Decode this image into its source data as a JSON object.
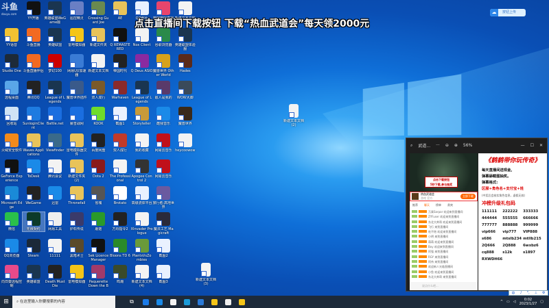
{
  "watermark": {
    "logo": "斗鱼",
    "site": "douyu.com"
  },
  "banner": "点击直播间下载按钮  下载“热血武道会”每天领2000元",
  "cloud_button": {
    "icon": "baidu-netdisk-icon",
    "label": "按钮上传"
  },
  "desktop": {
    "rows": [
      [
        [
          "YY开播",
          "#111"
        ],
        [
          "英雄联盟WeGame版",
          "#1a3550"
        ],
        [
          "遥控精灵",
          "#6a7fc4"
        ],
        [
          "Crossing Guard Joe",
          "#6a8a50"
        ],
        [
          "AE",
          "#e8c35a"
        ],
        [
          "QQ图片",
          "#e9f1ff"
        ],
        [
          "哔哩哔哩直播姬",
          "#e8456c"
        ],
        [
          "新建文本文档",
          "#f3f3f3"
        ]
      ],
      [
        [
          "YY语音",
          "#f2c232"
        ],
        [
          "斗鱼直播",
          "#f26a22"
        ],
        [
          "英雄联盟",
          "#1a3550"
        ],
        [
          "雷电模拟器",
          "#f5c518"
        ],
        [
          "新建文件夹",
          "#e8c35a"
        ],
        [
          "Q REMASTERED",
          "#111"
        ],
        [
          "Nox Client",
          "#f3f3f3"
        ],
        [
          "谷歌浏览器",
          "#2a8a4a"
        ],
        [
          "英雄联盟体验服",
          "#1a3550"
        ]
      ],
      [
        [
          "Studio One",
          "#1d2a38"
        ],
        [
          "斗鱼直播伴侣",
          "#f26a22"
        ],
        [
          "梦幻100",
          "#c00"
        ],
        [
          "网易UU加速器",
          "#3a7bd5"
        ],
        [
          "新建文本文档",
          "#f3f3f3"
        ],
        [
          "帝国时代",
          "#222"
        ],
        [
          "Q Deus ASIO",
          "#8a2aa0"
        ],
        [
          "魔兽世界 Other World",
          "#d6a21c"
        ],
        [
          "Hades",
          "#5a2a1a"
        ]
      ],
      [
        [
          "远程桌面",
          "#5aa6e8"
        ],
        [
          "腾讯QQ",
          "#222"
        ],
        [
          "League of Legends",
          "#1a3550"
        ],
        [
          "魔兽世界插件",
          "#3a5a8a"
        ],
        [
          "双人成行",
          "#7a5a2a"
        ],
        [
          "Warhaven",
          "#8a2a2a"
        ],
        [
          "League of Legends",
          "#1a3550"
        ],
        [
          "敌人是我的",
          "#5a3a6a"
        ],
        [
          "WOW大脚",
          "#3a4a5a"
        ]
      ],
      [
        [
          "回收站",
          "#cfe3f5"
        ],
        [
          "SunloginClient",
          "#1e7be0"
        ],
        [
          "Battle.net",
          "#1a6ee0"
        ],
        [
          "暴雪战网",
          "#1a6ee0"
        ],
        [
          "KOOK",
          "#6fdc2a"
        ],
        [
          "截图1",
          "#e9f1ff"
        ],
        [
          "Storyteller",
          "#c79a3a"
        ],
        [
          "酷我音乐",
          "#1a8ae8"
        ],
        [
          "魔兽世界",
          "#3a2a1a"
        ]
      ],
      [
        [
          "火绒安全软件",
          "#f28a1a"
        ],
        [
          "Waves Applications",
          "#e8c35a"
        ],
        [
          "Viewfinder",
          "#3a6a8a"
        ],
        [
          "雷电模拟器文件",
          "#e8c35a"
        ],
        [
          "百度网盘",
          "#222"
        ],
        [
          "双人成行",
          "#c03a2a"
        ],
        [
          "我的收藏",
          "#f3f3f3"
        ],
        [
          "网易云音乐",
          "#c0101a"
        ],
        [
          "heycoowow",
          "#f3f3f3"
        ]
      ],
      [
        [
          "GeForce Experience",
          "#111"
        ],
        [
          "ToDesk",
          "#1a8ae8"
        ],
        [
          "腾讯会议",
          "#f3f3f3"
        ],
        [
          "新建文件夹(2)",
          "#e8c35a"
        ],
        [
          "Dota 2",
          "#8a1a1a"
        ],
        [
          "The Professional",
          "#f3f3f3"
        ],
        [
          "Apogee Control 2",
          "#333"
        ],
        [
          "网易云音乐",
          "#c0101a"
        ]
      ],
      [
        [
          "Microsoft Edge",
          "#1a8ad8"
        ],
        [
          "WeGame",
          "#222"
        ],
        [
          "迅雷",
          "#1a8ae8"
        ],
        [
          "Thronefall",
          "#e8c35a"
        ],
        [
          "雀魂",
          "#555"
        ],
        [
          "Brotato",
          "#fff"
        ],
        [
          "高级流体平台",
          "#e9f1ff"
        ],
        [
          "旅行者:高地世界",
          "#6a5aa0"
        ]
      ],
      [
        [
          "微信",
          "#2ac04a"
        ],
        [
          "无畏契约",
          "#0c3a2a"
        ],
        [
          "网易工具",
          "#eee"
        ],
        [
          "炉石传说",
          "#3a3a6a"
        ],
        [
          "蘑菇",
          "#2a9a2a"
        ],
        [
          "方舟指令2",
          "#222"
        ],
        [
          "XInvader Prologue",
          "#f3f3f3"
        ],
        [
          "魔法工艺 Magicraft",
          "#2a2a3a"
        ]
      ],
      [
        [
          "QQ浏览器",
          "#1a8ae8"
        ],
        [
          "Steam",
          "#1b2838"
        ],
        [
          "11111",
          "#f3f3f3"
        ],
        [
          "黑暗术士",
          "#5a4a2a"
        ],
        [
          "Sek Licence Manager",
          "#111"
        ],
        [
          "Bloons TD 6",
          "#2a8a2a"
        ],
        [
          "PlantsVsZombies",
          "#6a9a3a"
        ],
        [
          "截图2",
          "#e9f1ff"
        ]
      ],
      [
        [
          "向日葵远程控制",
          "#e84a8a"
        ],
        [
          "英雄联盟",
          "#1a3550"
        ],
        [
          "Death Must Die",
          "#222"
        ],
        [
          "雷电模拟器",
          "#f5c518"
        ],
        [
          "Paquerette Down the Bunburrows",
          "#a03a6a"
        ],
        [
          "鸣潮",
          "#3a4a2a"
        ],
        [
          "新建文本文档(4)",
          "#f3f3f3"
        ],
        [
          "截图3",
          "#e9f1ff"
        ]
      ]
    ],
    "loose_files": [
      {
        "label": "新建文本文档(2)"
      },
      {
        "label": "新建文本文档(3)"
      }
    ]
  },
  "viewer": {
    "title": "武道...",
    "more": "···",
    "zoom": "56%",
    "game_popup": [
      "点击下载按钮",
      "5秒下载,参与抽奖"
    ],
    "game_name": "热血武道会",
    "game_sub": "游戏 官方",
    "download": "立即下载",
    "tabs": [
      "推荐",
      "聊天",
      "榜单",
      "贵宾"
    ],
    "chat": [
      "万乘Sarpar  欢迎来到直播间",
      "ZYFuser  欢迎来到直播间",
      "东北大帅哥  欢迎来到直播间",
      "飞行  来到直播间",
      "吃不饱  欢迎来到直播间",
      "小明  来到直播间",
      "萌萌  欢迎来到直播间",
      "Boy  欢迎来到直播间",
      "阿强  来到直播间",
      "RGY 来到直播间",
      "阿伟  来到直播间",
      "欢迎新人光临直播间",
      "小鱼  欢迎来到直播间",
      "东北大帅哥  来到直播间"
    ],
    "input_placeholder": "说点什么吧...",
    "promo": {
      "title": "《鹤鹤带你玩传奇》",
      "lines": [
        "每天直播间送现金,",
        "弹幕舔截图抽奖。",
        "弹幕格式:"
      ],
      "format": "区服+角色名+支付宝+姓",
      "note": "(中奖后会核实角色信息，虚假无效)",
      "codes_title": "冲榜升级礼包码",
      "codes": [
        "111111",
        "222222",
        "333333",
        "444444",
        "555555",
        "666666",
        "777777",
        "888888",
        "999999",
        "vip666",
        "vip777",
        "VIP888",
        "s686",
        "mtslb234",
        "mtllb215",
        "2Q666",
        "2Q888",
        "6wxbz6",
        "cq888",
        "s12k",
        "s1897",
        "RXWDH66"
      ]
    }
  },
  "taskbar": {
    "search_placeholder": "在这里输入你要搜索的内容",
    "apps": [
      [
        "kugou",
        "#1a7ae8"
      ],
      [
        "qq-browser",
        "#1a8ae8"
      ],
      [
        "douyu",
        "#f3f3f3"
      ],
      [
        "edge",
        "#1a9ad8"
      ],
      [
        "photos",
        "#2a7ad8"
      ],
      [
        "file-explorer",
        "#f5c518"
      ],
      [
        "game",
        "#eee"
      ],
      [
        "yy",
        "#f5c518"
      ]
    ],
    "time": "0:02",
    "date": "2023/1/27",
    "ime": [
      "中",
      "♪",
      "°,",
      "⊥",
      "⚙"
    ]
  }
}
